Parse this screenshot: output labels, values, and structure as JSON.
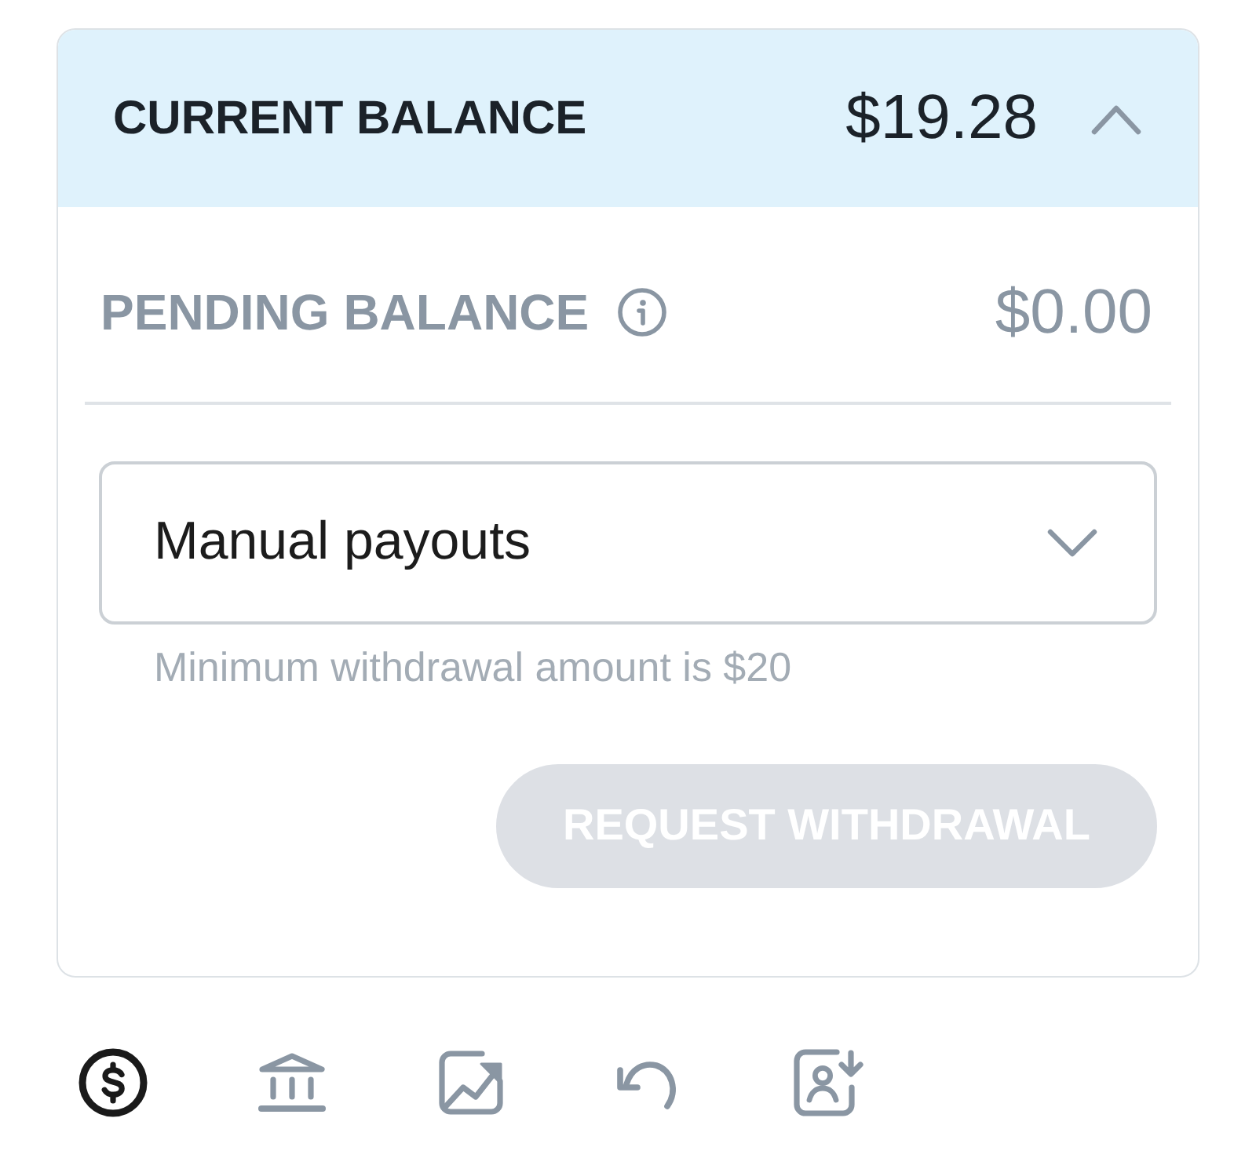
{
  "balance_panel": {
    "title": "CURRENT BALANCE",
    "amount": "$19.28",
    "expanded": true
  },
  "pending": {
    "label": "PENDING BALANCE",
    "amount": "$0.00"
  },
  "payout_select": {
    "value": "Manual payouts"
  },
  "hint": "Minimum withdrawal amount is $20",
  "withdraw_button": {
    "label": "REQUEST WITHDRAWAL",
    "disabled": true
  },
  "bottom_tabs": [
    {
      "kind": "dollar",
      "selected": true
    },
    {
      "kind": "bank",
      "selected": false
    },
    {
      "kind": "chart",
      "selected": false
    },
    {
      "kind": "undo",
      "selected": false
    },
    {
      "kind": "person-card",
      "selected": false
    }
  ]
}
